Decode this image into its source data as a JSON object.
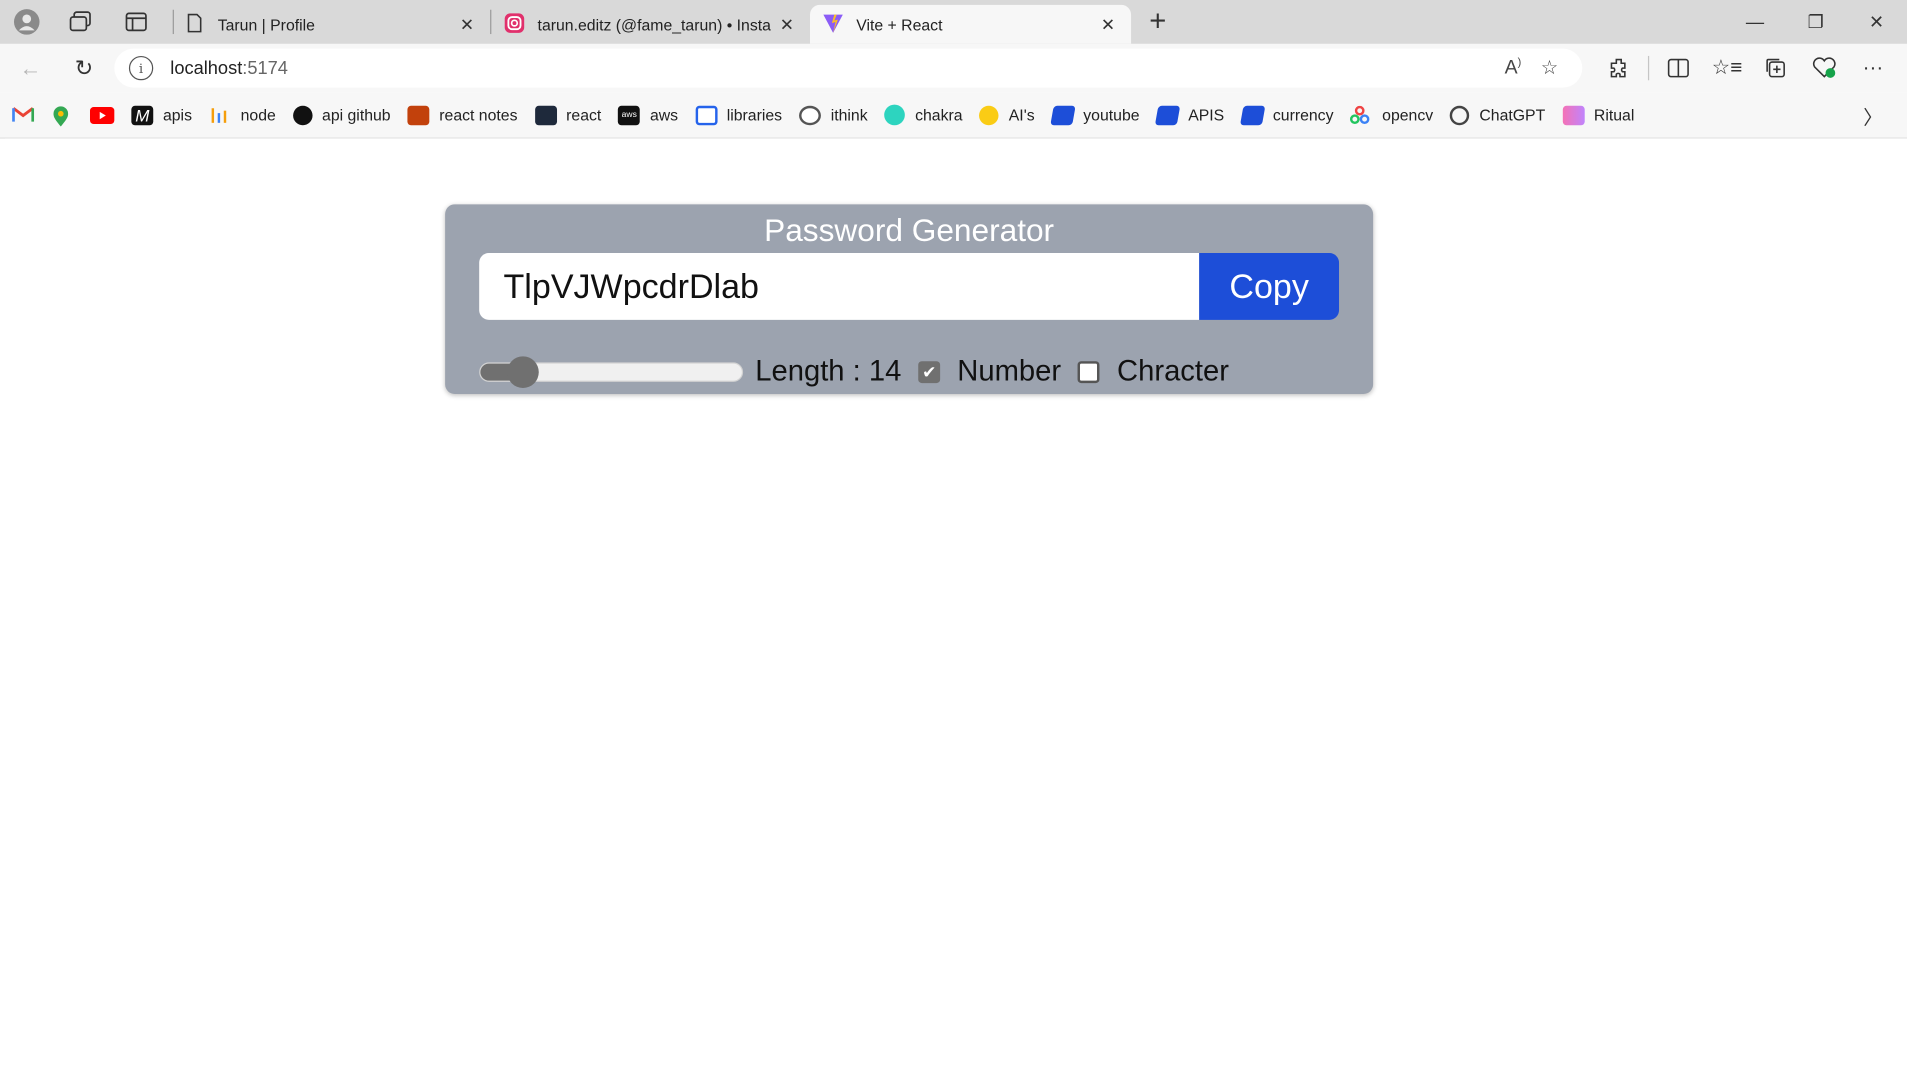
{
  "browser": {
    "tabs": [
      {
        "title": "Tarun | Profile"
      },
      {
        "title": "tarun.editz (@fame_tarun) • Insta"
      },
      {
        "title": "Vite + React"
      }
    ],
    "url_host": "localhost",
    "url_port": ":5174"
  },
  "bookmarks": [
    {
      "label": "apis"
    },
    {
      "label": "node"
    },
    {
      "label": "api github"
    },
    {
      "label": "react notes"
    },
    {
      "label": "react"
    },
    {
      "label": "aws"
    },
    {
      "label": "libraries"
    },
    {
      "label": "ithink"
    },
    {
      "label": "chakra"
    },
    {
      "label": "AI's"
    },
    {
      "label": "youtube"
    },
    {
      "label": "APIS"
    },
    {
      "label": "currency"
    },
    {
      "label": "opencv"
    },
    {
      "label": "ChatGPT"
    },
    {
      "label": "Ritual"
    }
  ],
  "app": {
    "title": "Password Generator",
    "password": "TlpVJWpcdrDlab",
    "copy_label": "Copy",
    "length_label": "Length : 14",
    "length_value": 14,
    "length_fraction": 0.11,
    "number_label": "Number",
    "number_checked": true,
    "character_label": "Chracter",
    "character_checked": false
  },
  "colors": {
    "card_bg": "#9ca3af",
    "copy_button": "#1d4ed8"
  }
}
